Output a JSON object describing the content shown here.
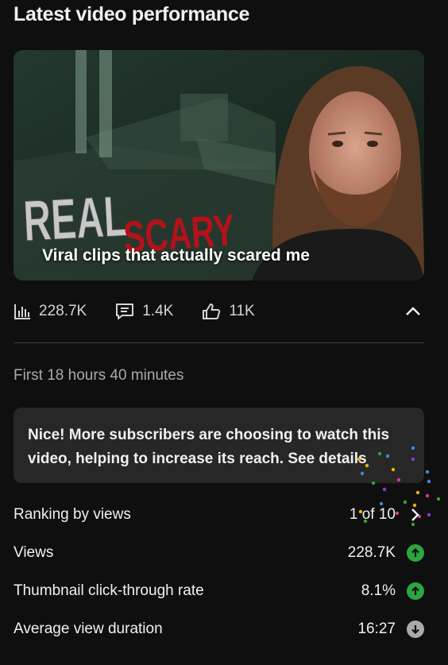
{
  "title": "Latest video performance",
  "video": {
    "caption": "Viral clips that actually scared me",
    "thumb_text_1": "REAL",
    "thumb_text_2": "SCARY"
  },
  "stats": {
    "views": "228.7K",
    "comments": "1.4K",
    "likes": "11K"
  },
  "period": "First 18 hours 40 minutes",
  "banner": {
    "text": "Nice! More subscribers are choosing to watch this video, helping to increase its reach. See details"
  },
  "metrics": [
    {
      "label": "Ranking by views",
      "value": "1 of 10",
      "indicator": "chevron-right"
    },
    {
      "label": "Views",
      "value": "228.7K",
      "indicator": "up"
    },
    {
      "label": "Thumbnail click-through rate",
      "value": "8.1%",
      "indicator": "up"
    },
    {
      "label": "Average view duration",
      "value": "16:27",
      "indicator": "down"
    }
  ],
  "colors": {
    "up": "#2ba640",
    "down": "#aaaaaa",
    "banner_bg": "#272727"
  }
}
